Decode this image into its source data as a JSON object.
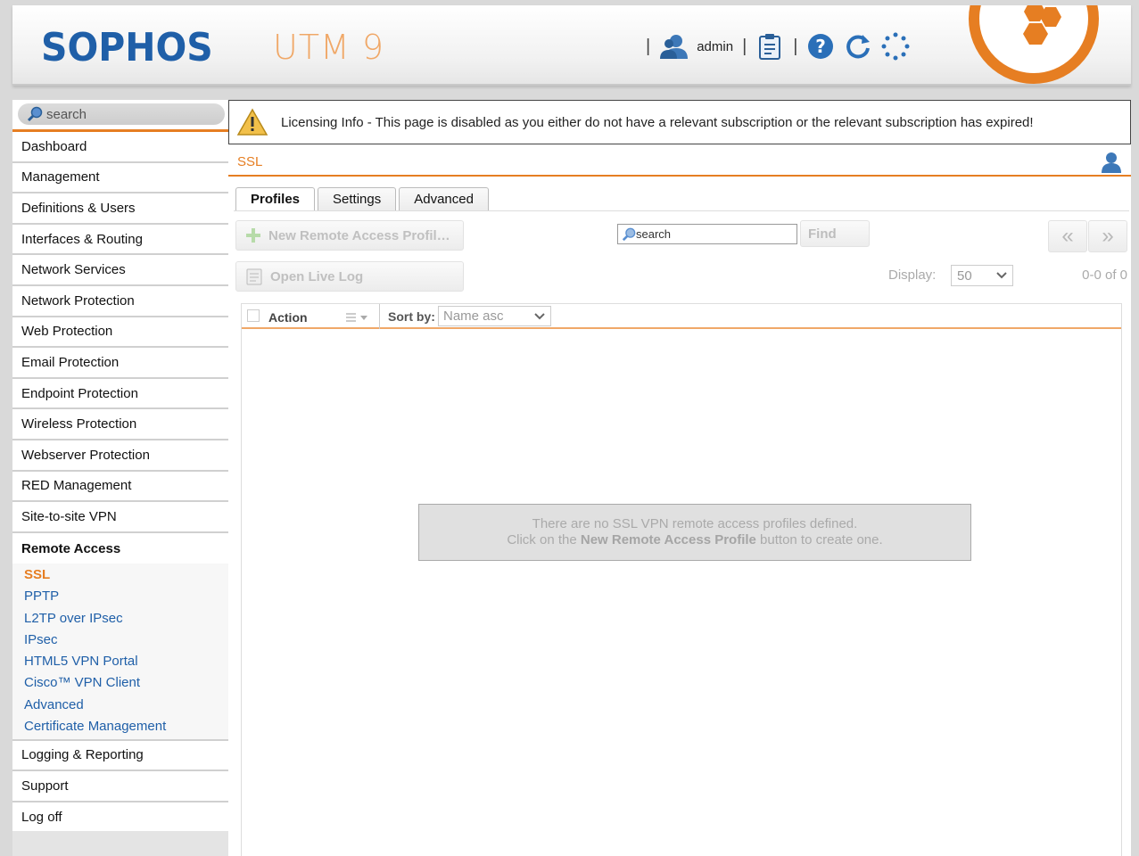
{
  "header": {
    "logo": "SOPHOS",
    "product": "UTM 9",
    "username": "admin",
    "sep": "|",
    "icons": [
      "user-icon",
      "clipboard-icon",
      "help-icon",
      "reload-icon",
      "spinner-icon"
    ]
  },
  "sidebar": {
    "search_placeholder": "search",
    "items": [
      {
        "label": "Dashboard"
      },
      {
        "label": "Management"
      },
      {
        "label": "Definitions & Users"
      },
      {
        "label": "Interfaces & Routing"
      },
      {
        "label": "Network Services"
      },
      {
        "label": "Network Protection"
      },
      {
        "label": "Web Protection"
      },
      {
        "label": "Email Protection"
      },
      {
        "label": "Endpoint Protection"
      },
      {
        "label": "Wireless Protection"
      },
      {
        "label": "Webserver Protection"
      },
      {
        "label": "RED Management"
      },
      {
        "label": "Site-to-site VPN"
      },
      {
        "label": "Remote Access"
      }
    ],
    "remote_access_sub": [
      {
        "label": "SSL"
      },
      {
        "label": "PPTP"
      },
      {
        "label": "L2TP over IPsec"
      },
      {
        "label": "IPsec"
      },
      {
        "label": "HTML5 VPN Portal"
      },
      {
        "label": "Cisco™ VPN Client"
      },
      {
        "label": "Advanced"
      },
      {
        "label": "Certificate Management"
      }
    ],
    "bottom_items": [
      {
        "label": "Logging & Reporting"
      },
      {
        "label": "Support"
      },
      {
        "label": "Log off"
      }
    ]
  },
  "main": {
    "licensing_info": "Licensing Info - This page is disabled as you either do not have a relevant subscription or the relevant subscription has expired!",
    "page_title": "SSL",
    "tabs": [
      {
        "label": "Profiles",
        "active": true
      },
      {
        "label": "Settings"
      },
      {
        "label": "Advanced"
      }
    ],
    "new_profile_btn": "New Remote Access Profil…",
    "open_live_log_btn": "Open Live Log",
    "search_placeholder": "search",
    "find_btn": "Find",
    "prev_page": "«",
    "next_page": "»",
    "display_label": "Display:",
    "display_value": "50",
    "range_text": "0-0 of 0",
    "list": {
      "action_label": "Action",
      "sort_label": "Sort by:",
      "sort_value": "Name asc",
      "empty_line1": "There are no SSL VPN remote access profiles defined.",
      "empty_line2_pre": "Click on the ",
      "empty_line2_bold": "New Remote Access Profile",
      "empty_line2_post": " button to create one."
    }
  },
  "colors": {
    "brand_blue": "#1f5fa8",
    "accent_orange": "#e67e22",
    "link_blue": "#1f5fa8"
  }
}
